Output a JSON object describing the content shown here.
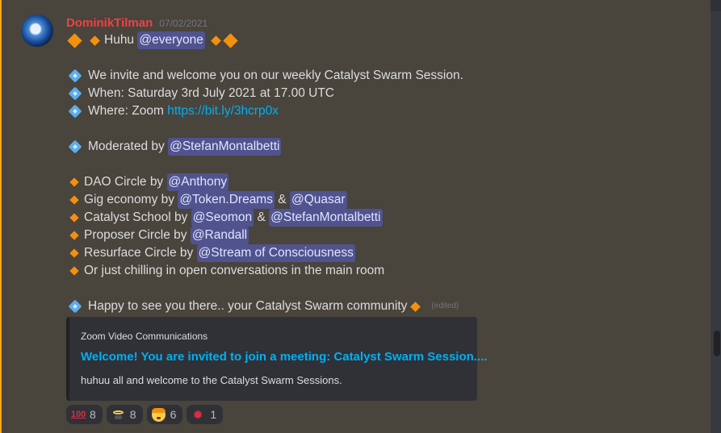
{
  "message": {
    "username": "DominikTilman",
    "timestamp": "07/02/2021",
    "lines": {
      "greeting": "Huhu",
      "greeting_mention": "@everyone",
      "invite": "We invite and welcome you on our weekly Catalyst Swarm Session.",
      "when": "When: Saturday 3rd July 2021 at 17.00 UTC",
      "where": "Where: Zoom",
      "where_link": "https://bit.ly/3hcrp0x",
      "moderated": "Moderated by",
      "moderator": "@StefanMontalbetti",
      "dao": "DAO Circle by",
      "dao_m1": "@Anthony",
      "gig": "Gig economy by",
      "gig_m1": "@Token.Dreams",
      "gig_amp": "&",
      "gig_m2": "@Quasar",
      "school": "Catalyst School by",
      "school_m1": "@Seomon",
      "school_amp": "&",
      "school_m2": "@StefanMontalbetti",
      "proposer": "Proposer Circle by",
      "proposer_m1": "@Randall",
      "resurface": "Resurface Circle by",
      "resurface_m1": "@Stream of Consciousness",
      "chilling": "Or just chilling in open conversations in the main room",
      "closing": "Happy to see you there.. your Catalyst Swarm community",
      "edited": "(edited)"
    },
    "embed": {
      "provider": "Zoom Video Communications",
      "title": "Welcome! You are invited to join a meeting: Catalyst Swarm Session....",
      "description": "huhuu all and welcome to the Catalyst Swarm Sessions."
    },
    "reactions": [
      {
        "icon": "hundred-points-icon",
        "count": "8"
      },
      {
        "icon": "halo-icon",
        "count": "8"
      },
      {
        "icon": "partying-face-icon",
        "count": "6"
      },
      {
        "icon": "collision-icon",
        "count": "1"
      }
    ]
  },
  "colors": {
    "username": "#ed4245",
    "link": "#00aff4",
    "mention_bg": "#5865f2",
    "highlight_bar": "#faa61a"
  }
}
